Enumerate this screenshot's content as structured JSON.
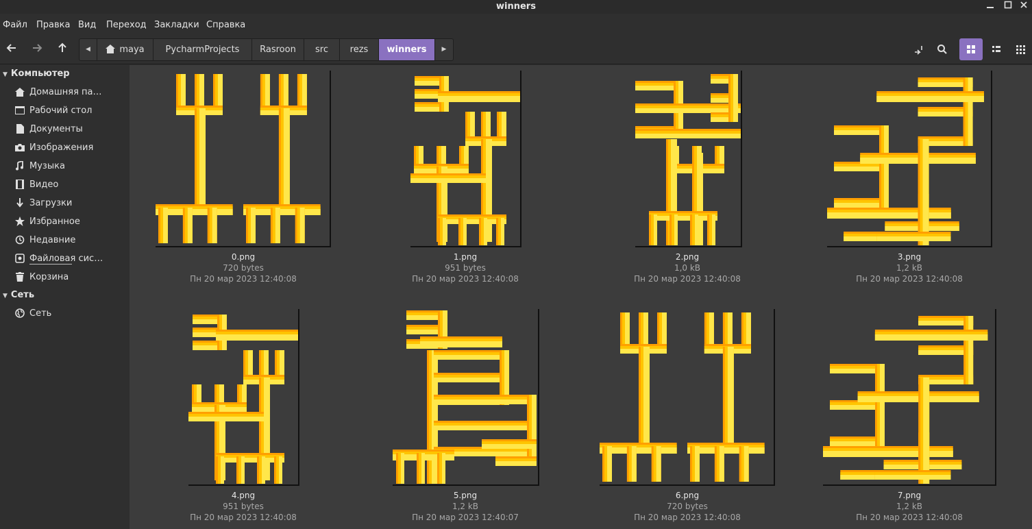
{
  "window": {
    "title": "winners"
  },
  "menu": [
    "Файл",
    "Правка",
    "Вид",
    "Переход",
    "Закладки",
    "Справка"
  ],
  "breadcrumbs": [
    "maya",
    "PycharmProjects",
    "Rasroon",
    "src",
    "rezs",
    "winners"
  ],
  "sidebar": {
    "sections": [
      {
        "title": "Компьютер",
        "items": [
          {
            "label": "Домашняя па…",
            "icon": "home-icon"
          },
          {
            "label": "Рабочий стол",
            "icon": "desktop-icon"
          },
          {
            "label": "Документы",
            "icon": "document-icon"
          },
          {
            "label": "Изображения",
            "icon": "camera-icon"
          },
          {
            "label": "Музыка",
            "icon": "music-icon"
          },
          {
            "label": "Видео",
            "icon": "video-icon"
          },
          {
            "label": "Загрузки",
            "icon": "download-icon"
          },
          {
            "label": "Избранное",
            "icon": "star-icon"
          },
          {
            "label": "Недавние",
            "icon": "recent-icon"
          },
          {
            "label": "Файловая сис…",
            "icon": "drive-icon"
          },
          {
            "label": "Корзина",
            "icon": "trash-icon"
          }
        ]
      },
      {
        "title": "Сеть",
        "items": [
          {
            "label": "Сеть",
            "icon": "network-icon"
          }
        ]
      }
    ]
  },
  "files": [
    {
      "name": "0.png",
      "size": "720 bytes",
      "date": "Пн 20 мар 2023 12:40:08"
    },
    {
      "name": "1.png",
      "size": "951 bytes",
      "date": "Пн 20 мар 2023 12:40:08"
    },
    {
      "name": "2.png",
      "size": "1,0 kB",
      "date": "Пн 20 мар 2023 12:40:08"
    },
    {
      "name": "3.png",
      "size": "1,2 kB",
      "date": "Пн 20 мар 2023 12:40:08"
    },
    {
      "name": "4.png",
      "size": "951 bytes",
      "date": "Пн 20 мар 2023 12:40:08"
    },
    {
      "name": "5.png",
      "size": "1,2 kB",
      "date": "Пн 20 мар 2023 12:40:07"
    },
    {
      "name": "6.png",
      "size": "720 bytes",
      "date": "Пн 20 мар 2023 12:40:08"
    },
    {
      "name": "7.png",
      "size": "1,2 kB",
      "date": "Пн 20 мар 2023 12:40:08"
    }
  ],
  "colors": {
    "accent": "#8a71c0",
    "thumb_light": "#ffe74a",
    "thumb_mid": "#ffc400",
    "thumb_dark": "#ff9f00"
  }
}
